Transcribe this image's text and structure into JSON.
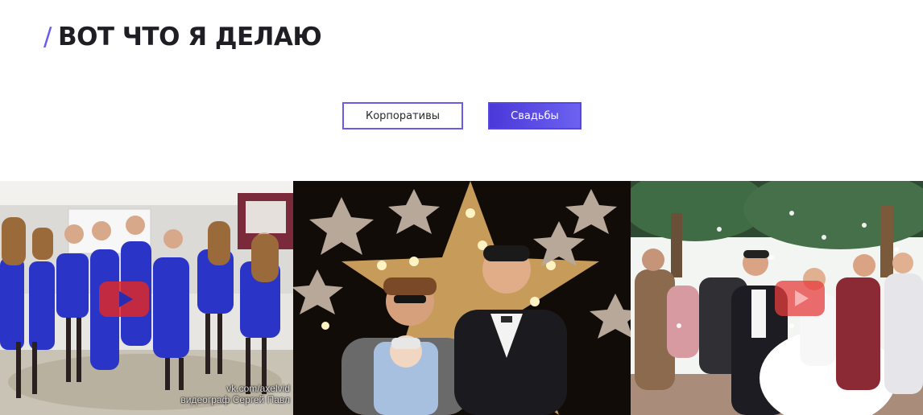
{
  "section": {
    "slash": "/",
    "title": "ВОТ ЧТО Я ДЕЛАЮ"
  },
  "tabs": [
    {
      "label": "Корпоративы",
      "active": false
    },
    {
      "label": "Свадьбы",
      "active": true
    }
  ],
  "colors": {
    "accent": "#6a5ce8",
    "heading": "#1e1e24",
    "play_button": "#dc2828"
  },
  "gallery": [
    {
      "kind": "video",
      "icon": "play-icon",
      "watermark_line1": "vk.com/axelvid",
      "watermark_line2": "видеограф Сергей Павл"
    },
    {
      "kind": "photo"
    },
    {
      "kind": "video",
      "icon": "play-icon"
    }
  ]
}
